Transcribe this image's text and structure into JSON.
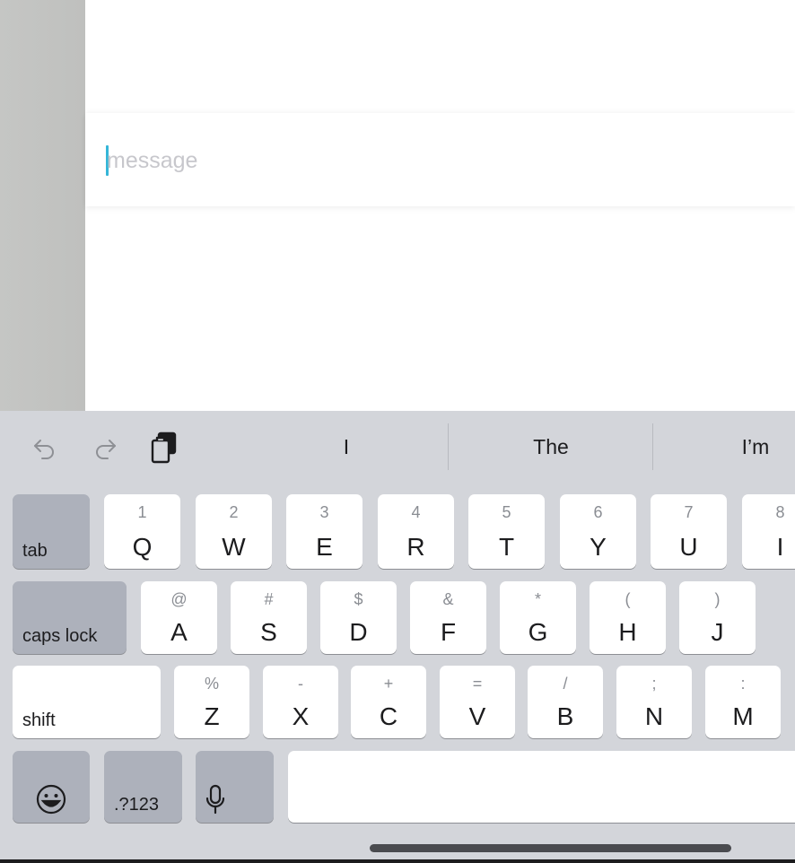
{
  "compose": {
    "placeholder": "message"
  },
  "toolbar": {
    "undo_icon": "undo-icon",
    "redo_icon": "redo-icon",
    "paste_icon": "clipboard-paste-icon"
  },
  "suggestions": [
    "I",
    "The",
    "I’m"
  ],
  "keyboard": {
    "tab": "tab",
    "caps_lock": "caps lock",
    "shift": "shift",
    "numbers": ".?123",
    "emoji_icon": "emoji-icon",
    "mic_icon": "microphone-icon",
    "row1": [
      {
        "main": "Q",
        "alt": "1"
      },
      {
        "main": "W",
        "alt": "2"
      },
      {
        "main": "E",
        "alt": "3"
      },
      {
        "main": "R",
        "alt": "4"
      },
      {
        "main": "T",
        "alt": "5"
      },
      {
        "main": "Y",
        "alt": "6"
      },
      {
        "main": "U",
        "alt": "7"
      },
      {
        "main": "I",
        "alt": "8"
      }
    ],
    "row2": [
      {
        "main": "A",
        "alt": "@"
      },
      {
        "main": "S",
        "alt": "#"
      },
      {
        "main": "D",
        "alt": "$"
      },
      {
        "main": "F",
        "alt": "&"
      },
      {
        "main": "G",
        "alt": "*"
      },
      {
        "main": "H",
        "alt": "("
      },
      {
        "main": "J",
        "alt": ")"
      }
    ],
    "row3": [
      {
        "main": "Z",
        "alt": "%"
      },
      {
        "main": "X",
        "alt": "-"
      },
      {
        "main": "C",
        "alt": "+"
      },
      {
        "main": "V",
        "alt": "="
      },
      {
        "main": "B",
        "alt": "/"
      },
      {
        "main": "N",
        "alt": ";"
      },
      {
        "main": "M",
        "alt": ":"
      }
    ]
  }
}
